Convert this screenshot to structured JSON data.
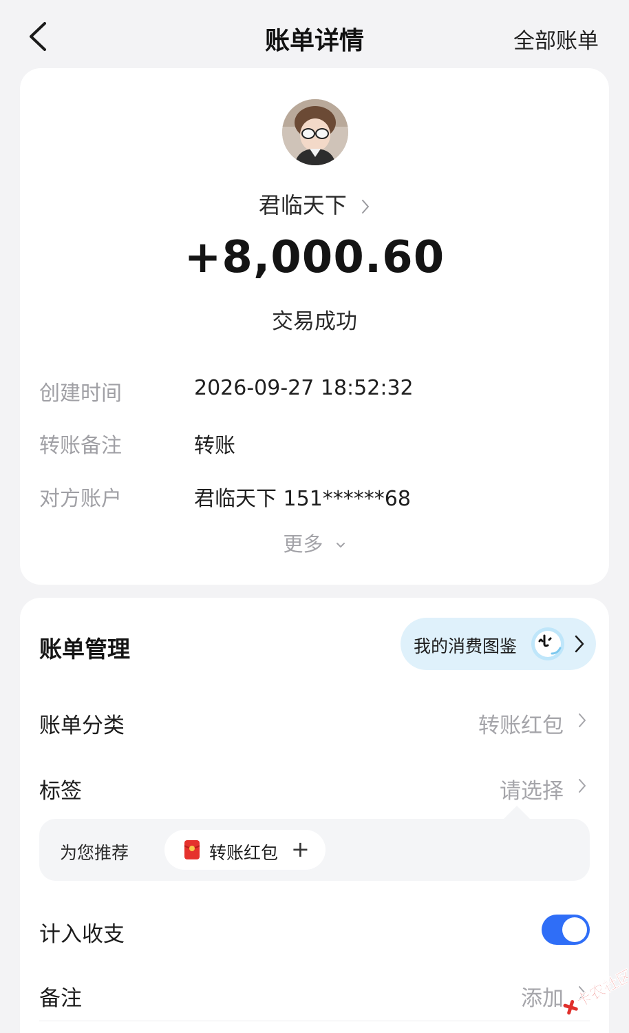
{
  "header": {
    "title": "账单详情",
    "all_bills": "全部账单"
  },
  "transaction": {
    "counterparty": "君临天下",
    "amount": "+8,000.60",
    "status": "交易成功",
    "details": [
      {
        "label": "创建时间",
        "value": "2026-09-27 18:52:32"
      },
      {
        "label": "转账备注",
        "value": "转账"
      },
      {
        "label": "对方账户",
        "value": "君临天下 151******68"
      }
    ],
    "more": "更多"
  },
  "management": {
    "title": "账单管理",
    "atlas_button": "我的消费图鉴",
    "category_label": "账单分类",
    "category_value": "转账红包",
    "tag_label": "标签",
    "tag_value": "请选择",
    "recommend_label": "为您推荐",
    "recommend_chip": "转账红包",
    "recommend_plus": "+",
    "count_label": "计入收支",
    "count_enabled": true,
    "note_label": "备注",
    "note_value": "添加"
  },
  "watermark": "卡农社区",
  "colors": {
    "toggle_on": "#2f6ef7",
    "pill_bg": "#dff1fb",
    "red_packet": "#e5322d"
  }
}
